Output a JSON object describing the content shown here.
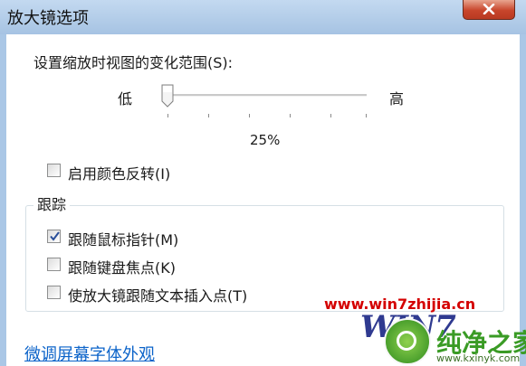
{
  "window": {
    "title": "放大镜选项"
  },
  "zoom": {
    "label": "设置缩放时视图的变化范围(S):",
    "low_label": "低",
    "high_label": "高",
    "value_text": "25%",
    "slider_level": 0
  },
  "color_invert": {
    "label": "启用颜色反转(I)",
    "checked": false
  },
  "tracking": {
    "group_label": "跟踪",
    "options": [
      {
        "label": "跟随鼠标指针(M)",
        "checked": true
      },
      {
        "label": "跟随键盘焦点(K)",
        "checked": false
      },
      {
        "label": "使放大镜跟随文本插入点(T)",
        "checked": false
      }
    ]
  },
  "link": {
    "label": "微调屏幕字体外观"
  },
  "watermark": {
    "url": "www.win7zhijia.cn",
    "logo_text": "WIN7",
    "site_text": "纯净之家",
    "site_url": "www.kxinyk.com"
  }
}
